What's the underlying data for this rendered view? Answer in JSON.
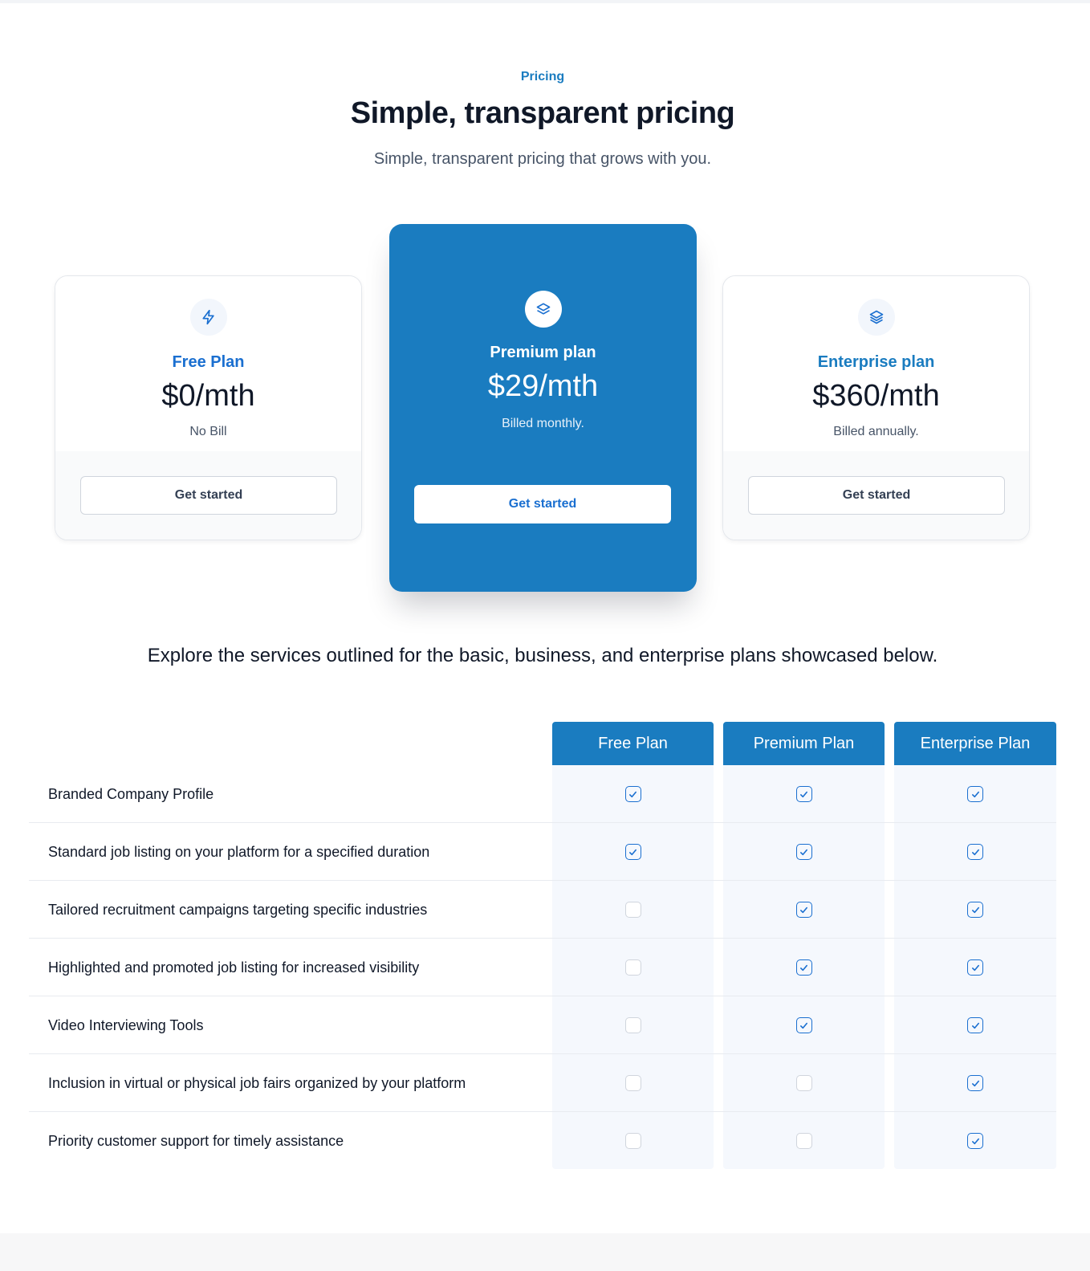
{
  "header": {
    "eyebrow": "Pricing",
    "title": "Simple, transparent pricing",
    "subtitle": "Simple, transparent pricing that grows with you."
  },
  "plans": [
    {
      "name": "Free Plan",
      "price": "$0/mth",
      "billing": "No Bill",
      "cta": "Get started",
      "icon": "zap-icon",
      "highlighted": false
    },
    {
      "name": "Premium plan",
      "price": "$29/mth",
      "billing": "Billed monthly.",
      "cta": "Get started",
      "icon": "layers-icon",
      "highlighted": true
    },
    {
      "name": "Enterprise plan",
      "price": "$360/mth",
      "billing": "Billed annually.",
      "cta": "Get started",
      "icon": "layers-three-icon",
      "highlighted": false
    }
  ],
  "comparison": {
    "intro": "Explore the services outlined for the basic, business, and enterprise plans showcased below.",
    "columns": [
      "Free Plan",
      "Premium Plan",
      "Enterprise Plan"
    ],
    "features": [
      {
        "label": "Branded Company Profile",
        "included": [
          true,
          true,
          true
        ]
      },
      {
        "label": "Standard job listing on your platform for a specified duration",
        "included": [
          true,
          true,
          true
        ]
      },
      {
        "label": "Tailored recruitment campaigns targeting specific industries",
        "included": [
          false,
          true,
          true
        ]
      },
      {
        "label": "Highlighted and promoted job listing for increased visibility",
        "included": [
          false,
          true,
          true
        ]
      },
      {
        "label": "Video Interviewing Tools",
        "included": [
          false,
          true,
          true
        ]
      },
      {
        "label": "Inclusion in virtual or physical job fairs organized by your platform",
        "included": [
          false,
          false,
          true
        ]
      },
      {
        "label": "Priority customer support for timely assistance",
        "included": [
          false,
          false,
          true
        ]
      }
    ]
  },
  "colors": {
    "accent": "#1a7cc0",
    "link_blue": "#1a6fd0",
    "text_dark": "#101828",
    "text_muted": "#475467",
    "table_body": "#f5f8fd"
  }
}
